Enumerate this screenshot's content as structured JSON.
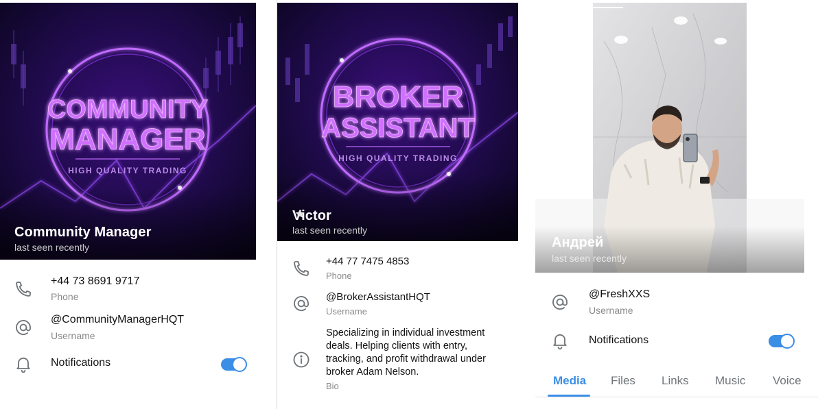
{
  "profile_1": {
    "cover_line1": "COMMUNITY",
    "cover_line2": "MANAGER",
    "cover_tagline": "HIGH QUALITY TRADING",
    "name": "Community Manager",
    "status": "last seen recently",
    "phone": {
      "value": "+44 73 8691 9717",
      "label": "Phone"
    },
    "username": {
      "value": "@CommunityManagerHQT",
      "label": "Username"
    },
    "notifications": {
      "label": "Notifications",
      "enabled": true
    }
  },
  "profile_2": {
    "cover_line1": "BROKER",
    "cover_line2": "ASSISTANT",
    "cover_tagline": "HIGH QUALITY TRADING",
    "name": "Victor",
    "status": "last seen recently",
    "phone": {
      "value": "+44 77 7475 4853",
      "label": "Phone"
    },
    "username": {
      "value": "@BrokerAssistantHQT",
      "label": "Username"
    },
    "bio": {
      "lines": [
        "Specializing in individual investment",
        "deals. Helping clients with entry,",
        "tracking, and profit withdrawal under",
        "broker Adam Nelson."
      ],
      "label": "Bio"
    }
  },
  "profile_3": {
    "name": "Андрей",
    "status": "last seen recently",
    "username": {
      "value": "@FreshXXS",
      "label": "Username"
    },
    "notifications": {
      "label": "Notifications",
      "enabled": true
    },
    "tabs": [
      "Media",
      "Files",
      "Links",
      "Music",
      "Voice"
    ],
    "active_tab": "Media"
  },
  "colors": {
    "accent": "#3a8ee6",
    "cover_bg": "#1a0a3d",
    "neon": "#b24dff",
    "secondary_text": "#8a8a8a"
  },
  "icons": [
    "phone-icon",
    "at-sign-icon",
    "bell-icon",
    "info-icon",
    "star-icon",
    "chevron-right-icon"
  ]
}
